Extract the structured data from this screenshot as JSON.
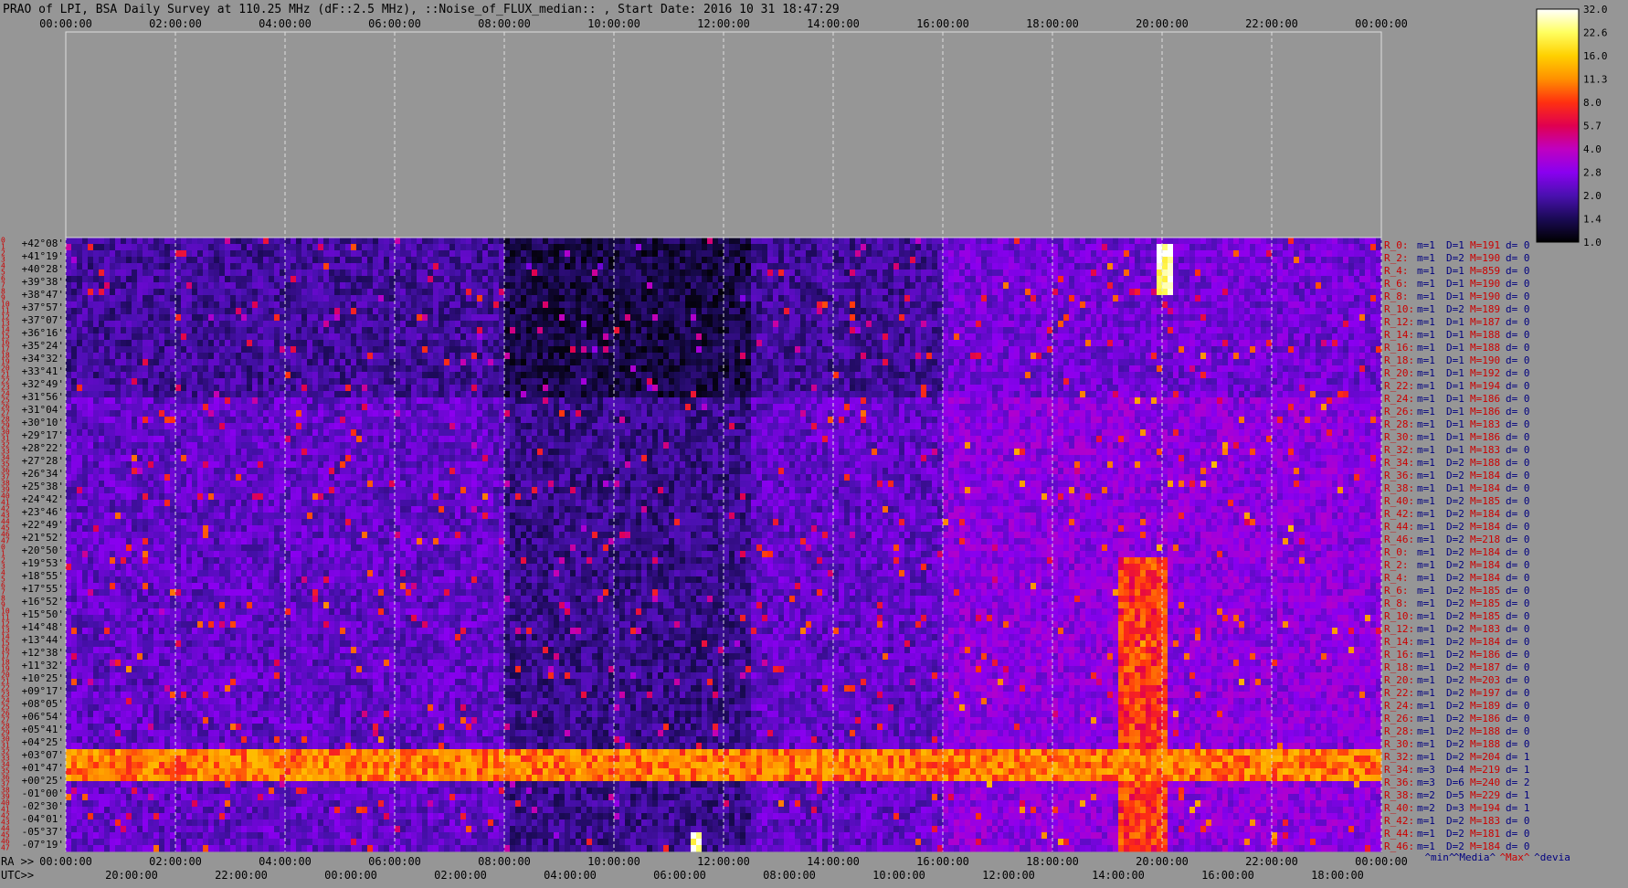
{
  "title": "PRAO of LPI, BSA Daily Survey at 110.25 MHz (dF::2.5 MHz), ::Noise_of_FLUX_median:: , Start Date: 2016 10 31 18:47:29",
  "colors": {
    "background": "#969696",
    "text": "#000000",
    "declination_label": "#000000",
    "row_index_label": "#cc0000",
    "stats_red": "#cc0000",
    "stats_blue": "#000080",
    "grid_line": "#dddddd"
  },
  "chart_data": {
    "type": "heatmap",
    "top_axis_ticks": [
      "00:00:00",
      "02:00:00",
      "04:00:00",
      "06:00:00",
      "08:00:00",
      "10:00:00",
      "12:00:00",
      "14:00:00",
      "16:00:00",
      "18:00:00",
      "20:00:00",
      "22:00:00",
      "00:00:00"
    ],
    "bottom_axis_prefix": "RA >>",
    "bottom_axis_ticks": [
      "00:00:00",
      "02:00:00",
      "04:00:00",
      "06:00:00",
      "08:00:00",
      "10:00:00",
      "12:00:00",
      "14:00:00",
      "16:00:00",
      "18:00:00",
      "20:00:00",
      "22:00:00",
      "00:00:00"
    ],
    "utc_axis_prefix": "UTC>>",
    "utc_axis_ticks": [
      "20:00:00",
      "22:00:00",
      "00:00:00",
      "02:00:00",
      "04:00:00",
      "06:00:00",
      "08:00:00",
      "10:00:00",
      "12:00:00",
      "14:00:00",
      "16:00:00",
      "18:00:00"
    ],
    "x_range_hours": [
      0,
      24
    ],
    "declinations": [
      "+42°08'",
      "+41°19'",
      "+40°28'",
      "+39°38'",
      "+38°47'",
      "+37°57'",
      "+37°07'",
      "+36°16'",
      "+35°24'",
      "+34°32'",
      "+33°41'",
      "+32°49'",
      "+31°56'",
      "+31°04'",
      "+30°10'",
      "+29°17'",
      "+28°22'",
      "+27°28'",
      "+26°34'",
      "+25°38'",
      "+24°42'",
      "+23°46'",
      "+22°49'",
      "+21°52'",
      "+20°50'",
      "+19°53'",
      "+18°55'",
      "+17°55'",
      "+16°52'",
      "+15°50'",
      "+14°48'",
      "+13°44'",
      "+12°38'",
      "+11°32'",
      "+10°25'",
      "+09°17'",
      "+08°05'",
      "+06°54'",
      "+05°41'",
      "+04°25'",
      "+03°07'",
      "+01°47'",
      "+00°25'",
      "-01°00'",
      "-02°30'",
      "-04°01'",
      "-05°37'",
      "-07°19'"
    ],
    "row_indices": [
      "0",
      "1",
      "2",
      "3",
      "4",
      "5",
      "6",
      "7",
      "8",
      "9",
      "10",
      "11",
      "12",
      "13",
      "14",
      "15",
      "16",
      "17",
      "18",
      "19",
      "20",
      "21",
      "22",
      "23",
      "24",
      "25",
      "26",
      "27",
      "28",
      "29",
      "30",
      "31",
      "32",
      "33",
      "34",
      "35",
      "36",
      "37",
      "38",
      "39",
      "40",
      "41",
      "42",
      "43",
      "44",
      "45",
      "46",
      "47",
      "0",
      "1",
      "2",
      "3",
      "4",
      "5",
      "6",
      "7",
      "8",
      "9",
      "10",
      "11",
      "12",
      "13",
      "14",
      "15",
      "16",
      "17",
      "18",
      "19",
      "20",
      "21",
      "22",
      "23",
      "24",
      "25",
      "26",
      "27",
      "28",
      "29",
      "30",
      "31",
      "32",
      "33",
      "34",
      "35",
      "36",
      "37",
      "38",
      "39",
      "40",
      "41",
      "42",
      "43",
      "44",
      "45",
      "46",
      "47"
    ],
    "row_stats": [
      {
        "r": "R_0:",
        "m": "m=1",
        "D": "D=1",
        "M": "M=191",
        "d": "d= 0"
      },
      {
        "r": "R_2:",
        "m": "m=1",
        "D": "D=2",
        "M": "M=190",
        "d": "d= 0"
      },
      {
        "r": "R_4:",
        "m": "m=1",
        "D": "D=1",
        "M": "M=859",
        "d": "d= 0"
      },
      {
        "r": "R_6:",
        "m": "m=1",
        "D": "D=1",
        "M": "M=190",
        "d": "d= 0"
      },
      {
        "r": "R_8:",
        "m": "m=1",
        "D": "D=1",
        "M": "M=190",
        "d": "d= 0"
      },
      {
        "r": "R_10:",
        "m": "m=1",
        "D": "D=2",
        "M": "M=189",
        "d": "d= 0"
      },
      {
        "r": "R_12:",
        "m": "m=1",
        "D": "D=1",
        "M": "M=187",
        "d": "d= 0"
      },
      {
        "r": "R_14:",
        "m": "m=1",
        "D": "D=1",
        "M": "M=188",
        "d": "d= 0"
      },
      {
        "r": "R_16:",
        "m": "m=1",
        "D": "D=1",
        "M": "M=188",
        "d": "d= 0"
      },
      {
        "r": "R_18:",
        "m": "m=1",
        "D": "D=1",
        "M": "M=190",
        "d": "d= 0"
      },
      {
        "r": "R_20:",
        "m": "m=1",
        "D": "D=1",
        "M": "M=192",
        "d": "d= 0"
      },
      {
        "r": "R_22:",
        "m": "m=1",
        "D": "D=1",
        "M": "M=194",
        "d": "d= 0"
      },
      {
        "r": "R_24:",
        "m": "m=1",
        "D": "D=1",
        "M": "M=186",
        "d": "d= 0"
      },
      {
        "r": "R_26:",
        "m": "m=1",
        "D": "D=1",
        "M": "M=186",
        "d": "d= 0"
      },
      {
        "r": "R_28:",
        "m": "m=1",
        "D": "D=1",
        "M": "M=183",
        "d": "d= 0"
      },
      {
        "r": "R_30:",
        "m": "m=1",
        "D": "D=1",
        "M": "M=186",
        "d": "d= 0"
      },
      {
        "r": "R_32:",
        "m": "m=1",
        "D": "D=1",
        "M": "M=183",
        "d": "d= 0"
      },
      {
        "r": "R_34:",
        "m": "m=1",
        "D": "D=2",
        "M": "M=188",
        "d": "d= 0"
      },
      {
        "r": "R_36:",
        "m": "m=1",
        "D": "D=2",
        "M": "M=184",
        "d": "d= 0"
      },
      {
        "r": "R_38:",
        "m": "m=1",
        "D": "D=1",
        "M": "M=184",
        "d": "d= 0"
      },
      {
        "r": "R_40:",
        "m": "m=1",
        "D": "D=2",
        "M": "M=185",
        "d": "d= 0"
      },
      {
        "r": "R_42:",
        "m": "m=1",
        "D": "D=2",
        "M": "M=184",
        "d": "d= 0"
      },
      {
        "r": "R_44:",
        "m": "m=1",
        "D": "D=2",
        "M": "M=184",
        "d": "d= 0"
      },
      {
        "r": "R_46:",
        "m": "m=1",
        "D": "D=2",
        "M": "M=218",
        "d": "d= 0"
      },
      {
        "r": "R_0:",
        "m": "m=1",
        "D": "D=2",
        "M": "M=184",
        "d": "d= 0"
      },
      {
        "r": "R_2:",
        "m": "m=1",
        "D": "D=2",
        "M": "M=184",
        "d": "d= 0"
      },
      {
        "r": "R_4:",
        "m": "m=1",
        "D": "D=2",
        "M": "M=184",
        "d": "d= 0"
      },
      {
        "r": "R_6:",
        "m": "m=1",
        "D": "D=2",
        "M": "M=185",
        "d": "d= 0"
      },
      {
        "r": "R_8:",
        "m": "m=1",
        "D": "D=2",
        "M": "M=185",
        "d": "d= 0"
      },
      {
        "r": "R_10:",
        "m": "m=1",
        "D": "D=2",
        "M": "M=185",
        "d": "d= 0"
      },
      {
        "r": "R_12:",
        "m": "m=1",
        "D": "D=2",
        "M": "M=183",
        "d": "d= 0"
      },
      {
        "r": "R_14:",
        "m": "m=1",
        "D": "D=2",
        "M": "M=184",
        "d": "d= 0"
      },
      {
        "r": "R_16:",
        "m": "m=1",
        "D": "D=2",
        "M": "M=186",
        "d": "d= 0"
      },
      {
        "r": "R_18:",
        "m": "m=1",
        "D": "D=2",
        "M": "M=187",
        "d": "d= 0"
      },
      {
        "r": "R_20:",
        "m": "m=1",
        "D": "D=2",
        "M": "M=203",
        "d": "d= 0"
      },
      {
        "r": "R_22:",
        "m": "m=1",
        "D": "D=2",
        "M": "M=197",
        "d": "d= 0"
      },
      {
        "r": "R_24:",
        "m": "m=1",
        "D": "D=2",
        "M": "M=189",
        "d": "d= 0"
      },
      {
        "r": "R_26:",
        "m": "m=1",
        "D": "D=2",
        "M": "M=186",
        "d": "d= 0"
      },
      {
        "r": "R_28:",
        "m": "m=1",
        "D": "D=2",
        "M": "M=188",
        "d": "d= 0"
      },
      {
        "r": "R_30:",
        "m": "m=1",
        "D": "D=2",
        "M": "M=188",
        "d": "d= 0"
      },
      {
        "r": "R_32:",
        "m": "m=1",
        "D": "D=2",
        "M": "M=204",
        "d": "d= 1"
      },
      {
        "r": "R_34:",
        "m": "m=3",
        "D": "D=4",
        "M": "M=219",
        "d": "d= 1"
      },
      {
        "r": "R_36:",
        "m": "m=3",
        "D": "D=6",
        "M": "M=240",
        "d": "d= 2"
      },
      {
        "r": "R_38:",
        "m": "m=2",
        "D": "D=5",
        "M": "M=229",
        "d": "d= 1"
      },
      {
        "r": "R_40:",
        "m": "m=2",
        "D": "D=3",
        "M": "M=194",
        "d": "d= 1"
      },
      {
        "r": "R_42:",
        "m": "m=1",
        "D": "D=2",
        "M": "M=183",
        "d": "d= 0"
      },
      {
        "r": "R_44:",
        "m": "m=1",
        "D": "D=2",
        "M": "M=181",
        "d": "d= 0"
      },
      {
        "r": "R_46:",
        "m": "m=1",
        "D": "D=2",
        "M": "M=184",
        "d": "d= 0"
      }
    ],
    "stats_legend": [
      "^min^",
      "^Media^",
      "^Max^",
      "^devia"
    ],
    "colorbar": {
      "ticks": [
        "32.0",
        "22.6",
        "16.0",
        "11.3",
        "8.0",
        "5.7",
        "4.0",
        "2.8",
        "2.0",
        "1.4",
        "1.0"
      ],
      "colors": [
        "#ffffff",
        "#ffff60",
        "#ffd000",
        "#ff9000",
        "#ff3010",
        "#e00050",
        "#c000c0",
        "#8a00f0",
        "#4a10b0",
        "#1a0a55",
        "#000000"
      ]
    },
    "features": [
      {
        "ra_hours": [
          0.0,
          24.0
        ],
        "row_range": [
          80,
          84
        ],
        "level": 12
      },
      {
        "ra_hours": [
          19.2,
          20.1
        ],
        "row_range": [
          50,
          95
        ],
        "level": 9
      },
      {
        "ra_hours": [
          19.9,
          20.2
        ],
        "row_range": [
          1,
          8
        ],
        "level": 32
      },
      {
        "ra_hours": [
          11.4,
          11.6
        ],
        "row_range": [
          93,
          95
        ],
        "level": 32
      }
    ]
  }
}
